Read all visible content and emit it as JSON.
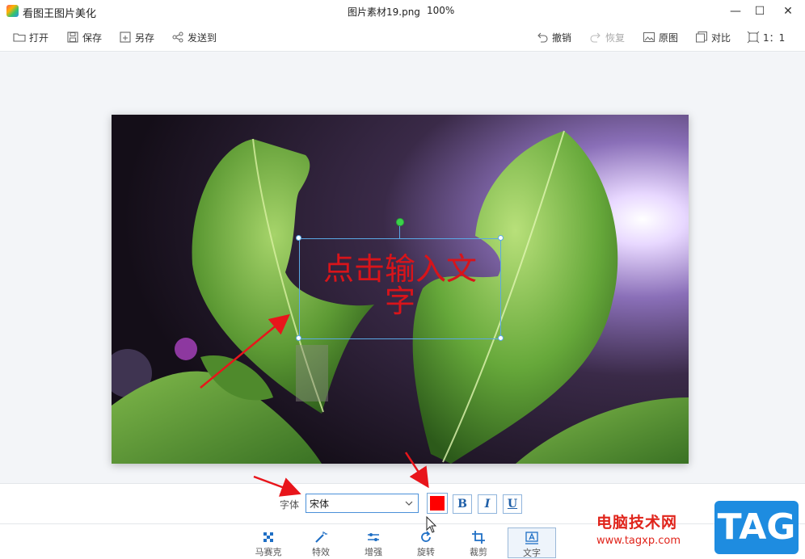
{
  "window": {
    "app_title": "看图王图片美化",
    "file_name": "图片素材19.png",
    "zoom": "100%",
    "minimize": "—",
    "maximize": "☐",
    "close": "✕"
  },
  "toolbar": {
    "open": "打开",
    "save": "保存",
    "save_as": "另存",
    "send_to": "发送到",
    "undo": "撤销",
    "redo": "恢复",
    "original": "原图",
    "compare": "对比",
    "ratio": "1：1"
  },
  "canvas": {
    "text_content": "点击输入文字",
    "text_color": "#d8141a"
  },
  "text_options": {
    "font_label": "字体",
    "font_value": "宋体",
    "color": "#ff0000",
    "bold": "B",
    "italic": "I",
    "underline": "U"
  },
  "tabs": [
    {
      "label": "马赛克",
      "icon": "mosaic-icon"
    },
    {
      "label": "特效",
      "icon": "magic-wand-icon"
    },
    {
      "label": "增强",
      "icon": "sliders-icon"
    },
    {
      "label": "旋转",
      "icon": "rotate-icon"
    },
    {
      "label": "裁剪",
      "icon": "crop-icon"
    },
    {
      "label": "文字",
      "icon": "text-icon",
      "active": true
    }
  ],
  "watermark": {
    "text": "电脑技术网",
    "url": "www.tagxp.com",
    "tag": "TAG"
  }
}
